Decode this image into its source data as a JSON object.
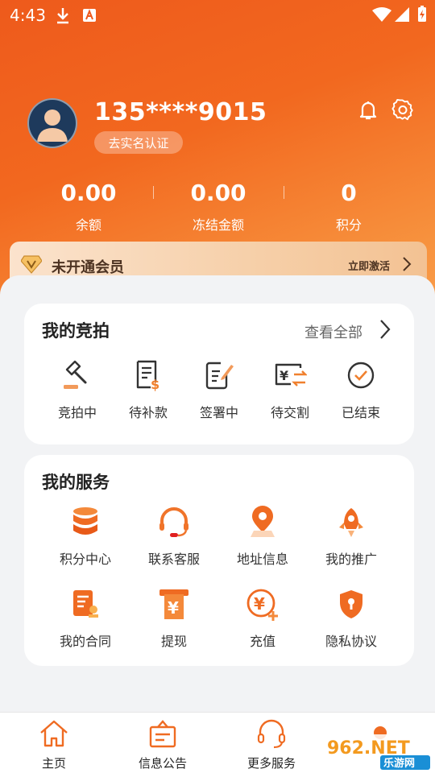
{
  "status_bar": {
    "time": "4:43"
  },
  "profile": {
    "phone": "135****9015",
    "verify_label": "去实名认证"
  },
  "stats": [
    {
      "value": "0.00",
      "label": "余额"
    },
    {
      "value": "0.00",
      "label": "冻结金额"
    },
    {
      "value": "0",
      "label": "积分"
    }
  ],
  "membership": {
    "title": "未开通会员",
    "action": "立即激活"
  },
  "auctions": {
    "title": "我的竞拍",
    "view_all": "查看全部",
    "items": [
      {
        "label": "竞拍中",
        "icon": "gavel-icon"
      },
      {
        "label": "待补款",
        "icon": "bill-dollar-icon"
      },
      {
        "label": "签署中",
        "icon": "sign-doc-icon"
      },
      {
        "label": "待交割",
        "icon": "yen-exchange-icon"
      },
      {
        "label": "已结束",
        "icon": "check-circle-icon"
      }
    ]
  },
  "services": {
    "title": "我的服务",
    "items": [
      {
        "label": "积分中心",
        "icon": "database-icon"
      },
      {
        "label": "联系客服",
        "icon": "headset-icon"
      },
      {
        "label": "地址信息",
        "icon": "location-pin-icon"
      },
      {
        "label": "我的推广",
        "icon": "rocket-icon"
      },
      {
        "label": "我的合同",
        "icon": "contract-icon"
      },
      {
        "label": "提现",
        "icon": "withdraw-icon"
      },
      {
        "label": "充值",
        "icon": "recharge-icon"
      },
      {
        "label": "隐私协议",
        "icon": "privacy-shield-icon"
      }
    ]
  },
  "tabs": [
    {
      "label": "主页",
      "icon": "home-icon"
    },
    {
      "label": "信息公告",
      "icon": "notice-icon"
    },
    {
      "label": "更多服务",
      "icon": "headset-icon"
    }
  ],
  "watermark": {
    "brand": "962.NET",
    "sub": "乐游网"
  },
  "colors": {
    "primary": "#f05a1a",
    "accent": "#f7a04e",
    "vip_text": "#4d3322"
  }
}
